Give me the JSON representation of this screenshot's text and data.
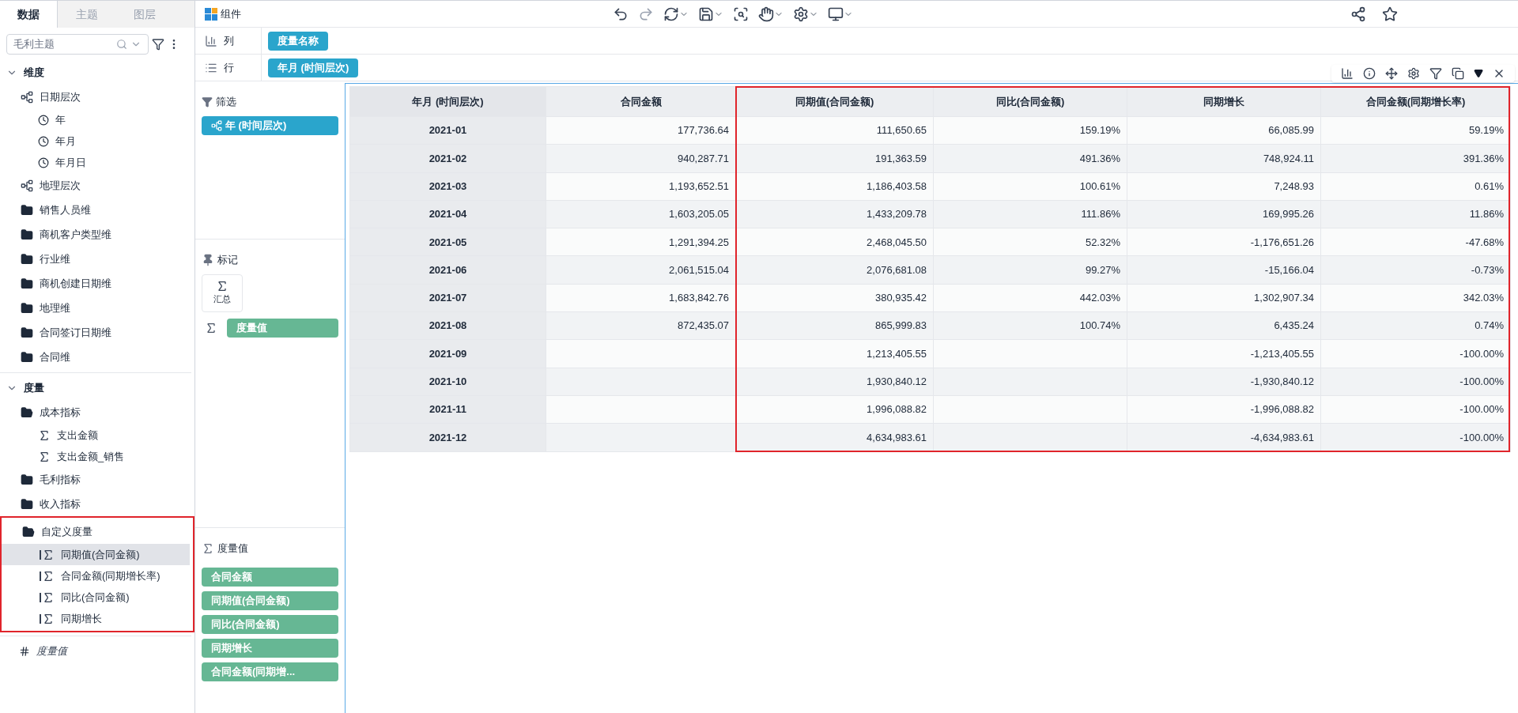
{
  "left_panel": {
    "tabs": [
      {
        "label": "数据",
        "selected": true
      },
      {
        "label": "主题",
        "selected": false
      },
      {
        "label": "图层",
        "selected": false
      }
    ],
    "search": {
      "value": "毛利主题"
    },
    "tree": [
      {
        "label": "维度",
        "kind": "section",
        "expanded": true,
        "children": [
          {
            "label": "日期层次",
            "kind": "hierarchy",
            "children": [
              {
                "label": "年",
                "kind": "time"
              },
              {
                "label": "年月",
                "kind": "time"
              },
              {
                "label": "年月日",
                "kind": "time"
              }
            ]
          },
          {
            "label": "地理层次",
            "kind": "hierarchy"
          },
          {
            "label": "销售人员维",
            "kind": "folder"
          },
          {
            "label": "商机客户类型维",
            "kind": "folder"
          },
          {
            "label": "行业维",
            "kind": "folder"
          },
          {
            "label": "商机创建日期维",
            "kind": "folder"
          },
          {
            "label": "地理维",
            "kind": "folder"
          },
          {
            "label": "合同签订日期维",
            "kind": "folder"
          },
          {
            "label": "合同维",
            "kind": "folder"
          }
        ]
      },
      {
        "label": "度量",
        "kind": "section",
        "expanded": true,
        "children": [
          {
            "label": "成本指标",
            "kind": "folder-open",
            "children": [
              {
                "label": "支出金额",
                "kind": "measure"
              },
              {
                "label": "支出金额_销售",
                "kind": "measure"
              }
            ]
          },
          {
            "label": "毛利指标",
            "kind": "folder"
          },
          {
            "label": "收入指标",
            "kind": "folder"
          },
          {
            "label": "自定义度量",
            "kind": "folder-open",
            "highlighted": true,
            "children": [
              {
                "label": "同期值(合同金额)",
                "kind": "calc-measure",
                "selected": true
              },
              {
                "label": "合同金额(同期增长率)",
                "kind": "calc-measure",
                "selected": false
              },
              {
                "label": "同比(合同金额)",
                "kind": "calc-measure",
                "selected": false
              },
              {
                "label": "同期增长",
                "kind": "calc-measure",
                "selected": false
              }
            ]
          }
        ]
      },
      {
        "label": "度量值",
        "kind": "measure-values"
      }
    ]
  },
  "toolbar": {
    "title": "组件"
  },
  "shelves": [
    {
      "kind": "columns",
      "label": "列",
      "pills": [
        "度量名称"
      ]
    },
    {
      "kind": "rows",
      "label": "行",
      "pills": [
        "年月 (时间层次)"
      ]
    }
  ],
  "filter_panel": {
    "title": "筛选",
    "pills": [
      "年 (时间层次)"
    ]
  },
  "marks_panel": {
    "title": "标记",
    "mark_type": "汇总",
    "pills": [
      "度量值"
    ]
  },
  "measure_values_panel": {
    "title": "度量值",
    "pills": [
      "合同金额",
      "同期值(合同金额)",
      "同比(合同金额)",
      "同期增长",
      "合同金额(同期增..."
    ]
  },
  "table": {
    "columns": [
      {
        "label": "年月 (时间层次)",
        "highlighted": false
      },
      {
        "label": "合同金额",
        "highlighted": false
      },
      {
        "label": "同期值(合同金额)",
        "highlighted": true
      },
      {
        "label": "同比(合同金额)",
        "highlighted": true
      },
      {
        "label": "同期增长",
        "highlighted": true
      },
      {
        "label": "合同金额(同期增长率)",
        "highlighted": true
      }
    ],
    "rows": [
      [
        "2021-01",
        "177,736.64",
        "111,650.65",
        "159.19%",
        "66,085.99",
        "59.19%"
      ],
      [
        "2021-02",
        "940,287.71",
        "191,363.59",
        "491.36%",
        "748,924.11",
        "391.36%"
      ],
      [
        "2021-03",
        "1,193,652.51",
        "1,186,403.58",
        "100.61%",
        "7,248.93",
        "0.61%"
      ],
      [
        "2021-04",
        "1,603,205.05",
        "1,433,209.78",
        "111.86%",
        "169,995.26",
        "11.86%"
      ],
      [
        "2021-05",
        "1,291,394.25",
        "2,468,045.50",
        "52.32%",
        "-1,176,651.26",
        "-47.68%"
      ],
      [
        "2021-06",
        "2,061,515.04",
        "2,076,681.08",
        "99.27%",
        "-15,166.04",
        "-0.73%"
      ],
      [
        "2021-07",
        "1,683,842.76",
        "380,935.42",
        "442.03%",
        "1,302,907.34",
        "342.03%"
      ],
      [
        "2021-08",
        "872,435.07",
        "865,999.83",
        "100.74%",
        "6,435.24",
        "0.74%"
      ],
      [
        "2021-09",
        null,
        "1,213,405.55",
        null,
        "-1,213,405.55",
        "-100.00%"
      ],
      [
        "2021-10",
        null,
        "1,930,840.12",
        null,
        "-1,930,840.12",
        "-100.00%"
      ],
      [
        "2021-11",
        null,
        "1,996,088.82",
        null,
        "-1,996,088.82",
        "-100.00%"
      ],
      [
        "2021-12",
        null,
        "4,634,983.61",
        null,
        "-4,634,983.61",
        "-100.00%"
      ]
    ]
  }
}
